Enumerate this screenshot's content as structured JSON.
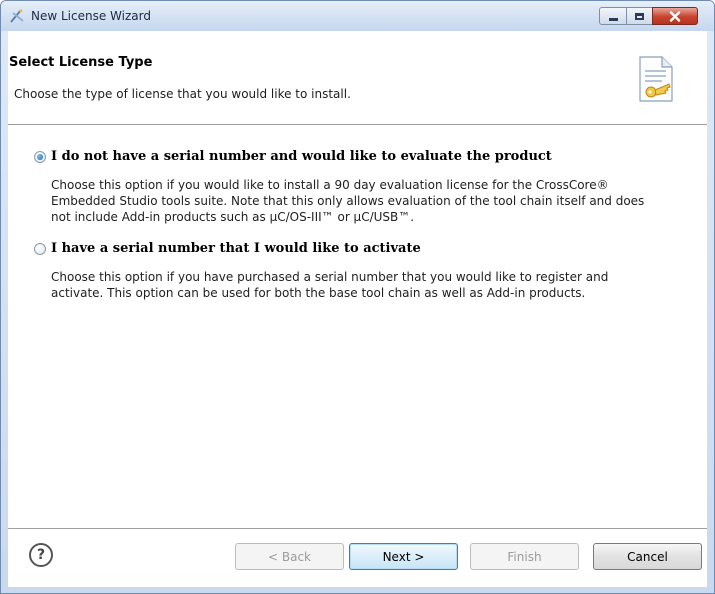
{
  "window": {
    "title": "New License Wizard"
  },
  "header": {
    "title": "Select License Type",
    "description": "Choose the type of license that you would like to install."
  },
  "options": [
    {
      "label": "I do not have a serial number and would like to evaluate the product",
      "selected": true,
      "description_lines": [
        "Choose this option if you would like to install a 90 day evaluation license for the CrossCore®",
        "Embedded Studio tools suite. Note that this only allows evaluation of the tool chain itself and does",
        "not include Add-in products such as µC/OS-III™ or µC/USB™."
      ]
    },
    {
      "label": "I have a serial number that I would like to activate",
      "selected": false,
      "description_lines": [
        "Choose this option if you have purchased a serial number that you would like to register and",
        "activate. This option can be used for both the base tool chain as well as Add-in products."
      ]
    }
  ],
  "footer": {
    "help_symbol": "?",
    "back_label": "< Back",
    "next_label": "Next >",
    "finish_label": "Finish",
    "cancel_label": "Cancel"
  },
  "icons": {
    "app": "wizard-icon",
    "header": "license-document-key-icon",
    "help": "help-icon"
  },
  "colors": {
    "titlebar": "#d5e2f3",
    "close_button": "#c7432f",
    "radio_selected": "#1d5f9e",
    "default_button_border": "#3c7fb1"
  }
}
